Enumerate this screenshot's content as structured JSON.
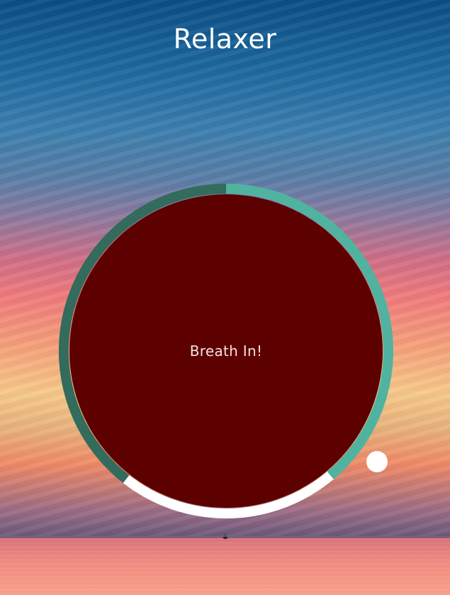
{
  "app": {
    "title": "Relaxer"
  },
  "breather": {
    "instruction": "Breath In!",
    "colors": {
      "circle": "#5c0000",
      "ring_primary": "#4fb3a0",
      "ring_dark": "#336b5c",
      "ring_hold": "#ffffff",
      "pointer": "#ffffff"
    }
  }
}
